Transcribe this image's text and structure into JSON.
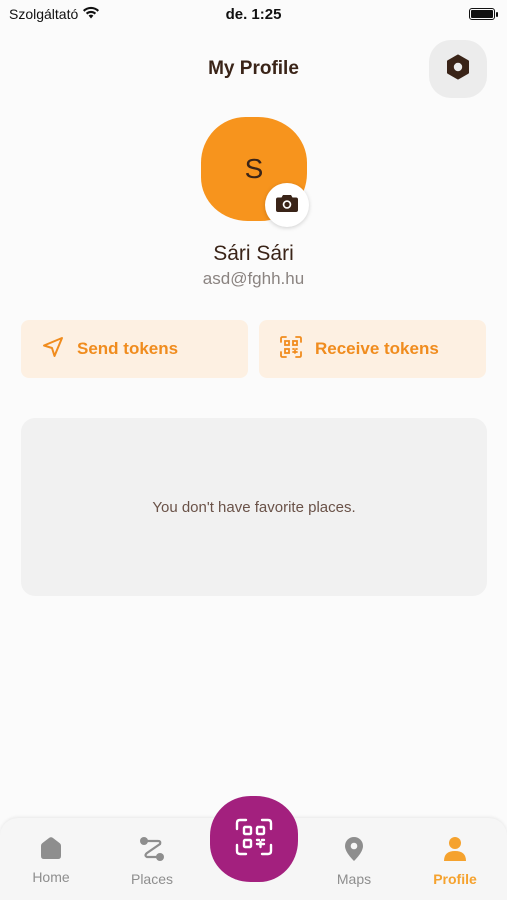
{
  "status_bar": {
    "carrier": "Szolgáltató",
    "time": "de. 1:25"
  },
  "header": {
    "title": "My Profile",
    "settings_icon": "settings-hex-icon"
  },
  "profile": {
    "avatar_initial": "S",
    "avatar_color": "#f7941d",
    "name": "Sári Sári",
    "email": "asd@fghh.hu"
  },
  "actions": {
    "send_label": "Send tokens",
    "receive_label": "Receive tokens",
    "accent": "#f08c1e",
    "background": "#fdf0e2"
  },
  "favorites": {
    "empty_text": "You don't have favorite places."
  },
  "tab_bar": {
    "items": [
      {
        "label": "Home",
        "icon": "home-icon",
        "active": false
      },
      {
        "label": "Places",
        "icon": "route-icon",
        "active": false
      },
      {
        "label": "Maps",
        "icon": "map-pin-icon",
        "active": false
      },
      {
        "label": "Profile",
        "icon": "person-icon",
        "active": true
      }
    ],
    "scan_icon": "qr-scan-icon",
    "scan_color": "#a3207e",
    "active_color": "#f5a22e"
  }
}
